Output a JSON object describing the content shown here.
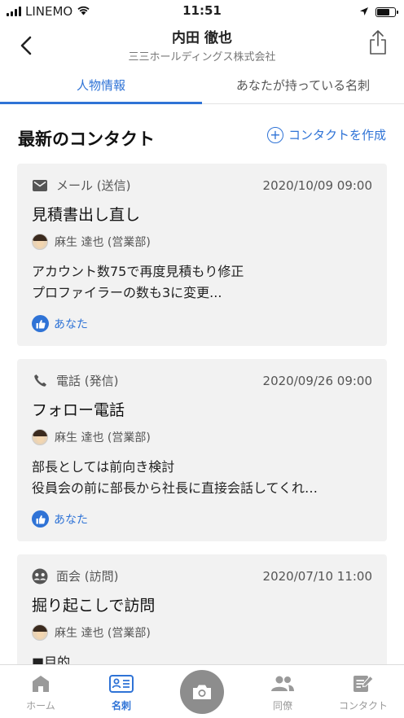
{
  "status_bar": {
    "carrier": "LINEMO",
    "time": "11:51"
  },
  "header": {
    "title": "内田 徹也",
    "subtitle": "三三ホールディングス株式会社"
  },
  "tabs": [
    {
      "label": "人物情報",
      "active": true
    },
    {
      "label": "あなたが持っている名刺",
      "active": false
    }
  ],
  "section": {
    "title": "最新のコンタクト",
    "create_label": "コンタクトを作成"
  },
  "contacts": [
    {
      "type_icon": "mail-icon",
      "type": "メール (送信)",
      "date": "2020/10/09 09:00",
      "title": "見積書出し直し",
      "person": "麻生 達也 (営業部)",
      "body": [
        "アカウント数75で再度見積もり修正",
        "プロファイラーの数も3に変更..."
      ],
      "like": "あなた"
    },
    {
      "type_icon": "phone-icon",
      "type": "電話 (発信)",
      "date": "2020/09/26 09:00",
      "title": "フォロー電話",
      "person": "麻生 達也 (営業部)",
      "body": [
        "部長としては前向き検討",
        "役員会の前に部長から社長に直接会話してくれ…"
      ],
      "like": "あなた"
    },
    {
      "type_icon": "meeting-icon",
      "type": "面会 (訪問)",
      "date": "2020/07/10 11:00",
      "title": "掘り起こしで訪問",
      "person": "麻生 達也 (営業部)",
      "body": [
        "■目的"
      ]
    }
  ],
  "bottom_nav": [
    {
      "label": "ホーム",
      "icon": "home-icon",
      "active": false
    },
    {
      "label": "名刺",
      "icon": "business-card-icon",
      "active": true
    },
    {
      "label": "",
      "icon": "camera-icon",
      "active": false
    },
    {
      "label": "同僚",
      "icon": "colleagues-icon",
      "active": false
    },
    {
      "label": "コンタクト",
      "icon": "contact-edit-icon",
      "active": false
    }
  ],
  "colors": {
    "accent": "#2f73d6",
    "card_bg": "#f2f2f2",
    "camera_bg": "#8d8d8d"
  }
}
